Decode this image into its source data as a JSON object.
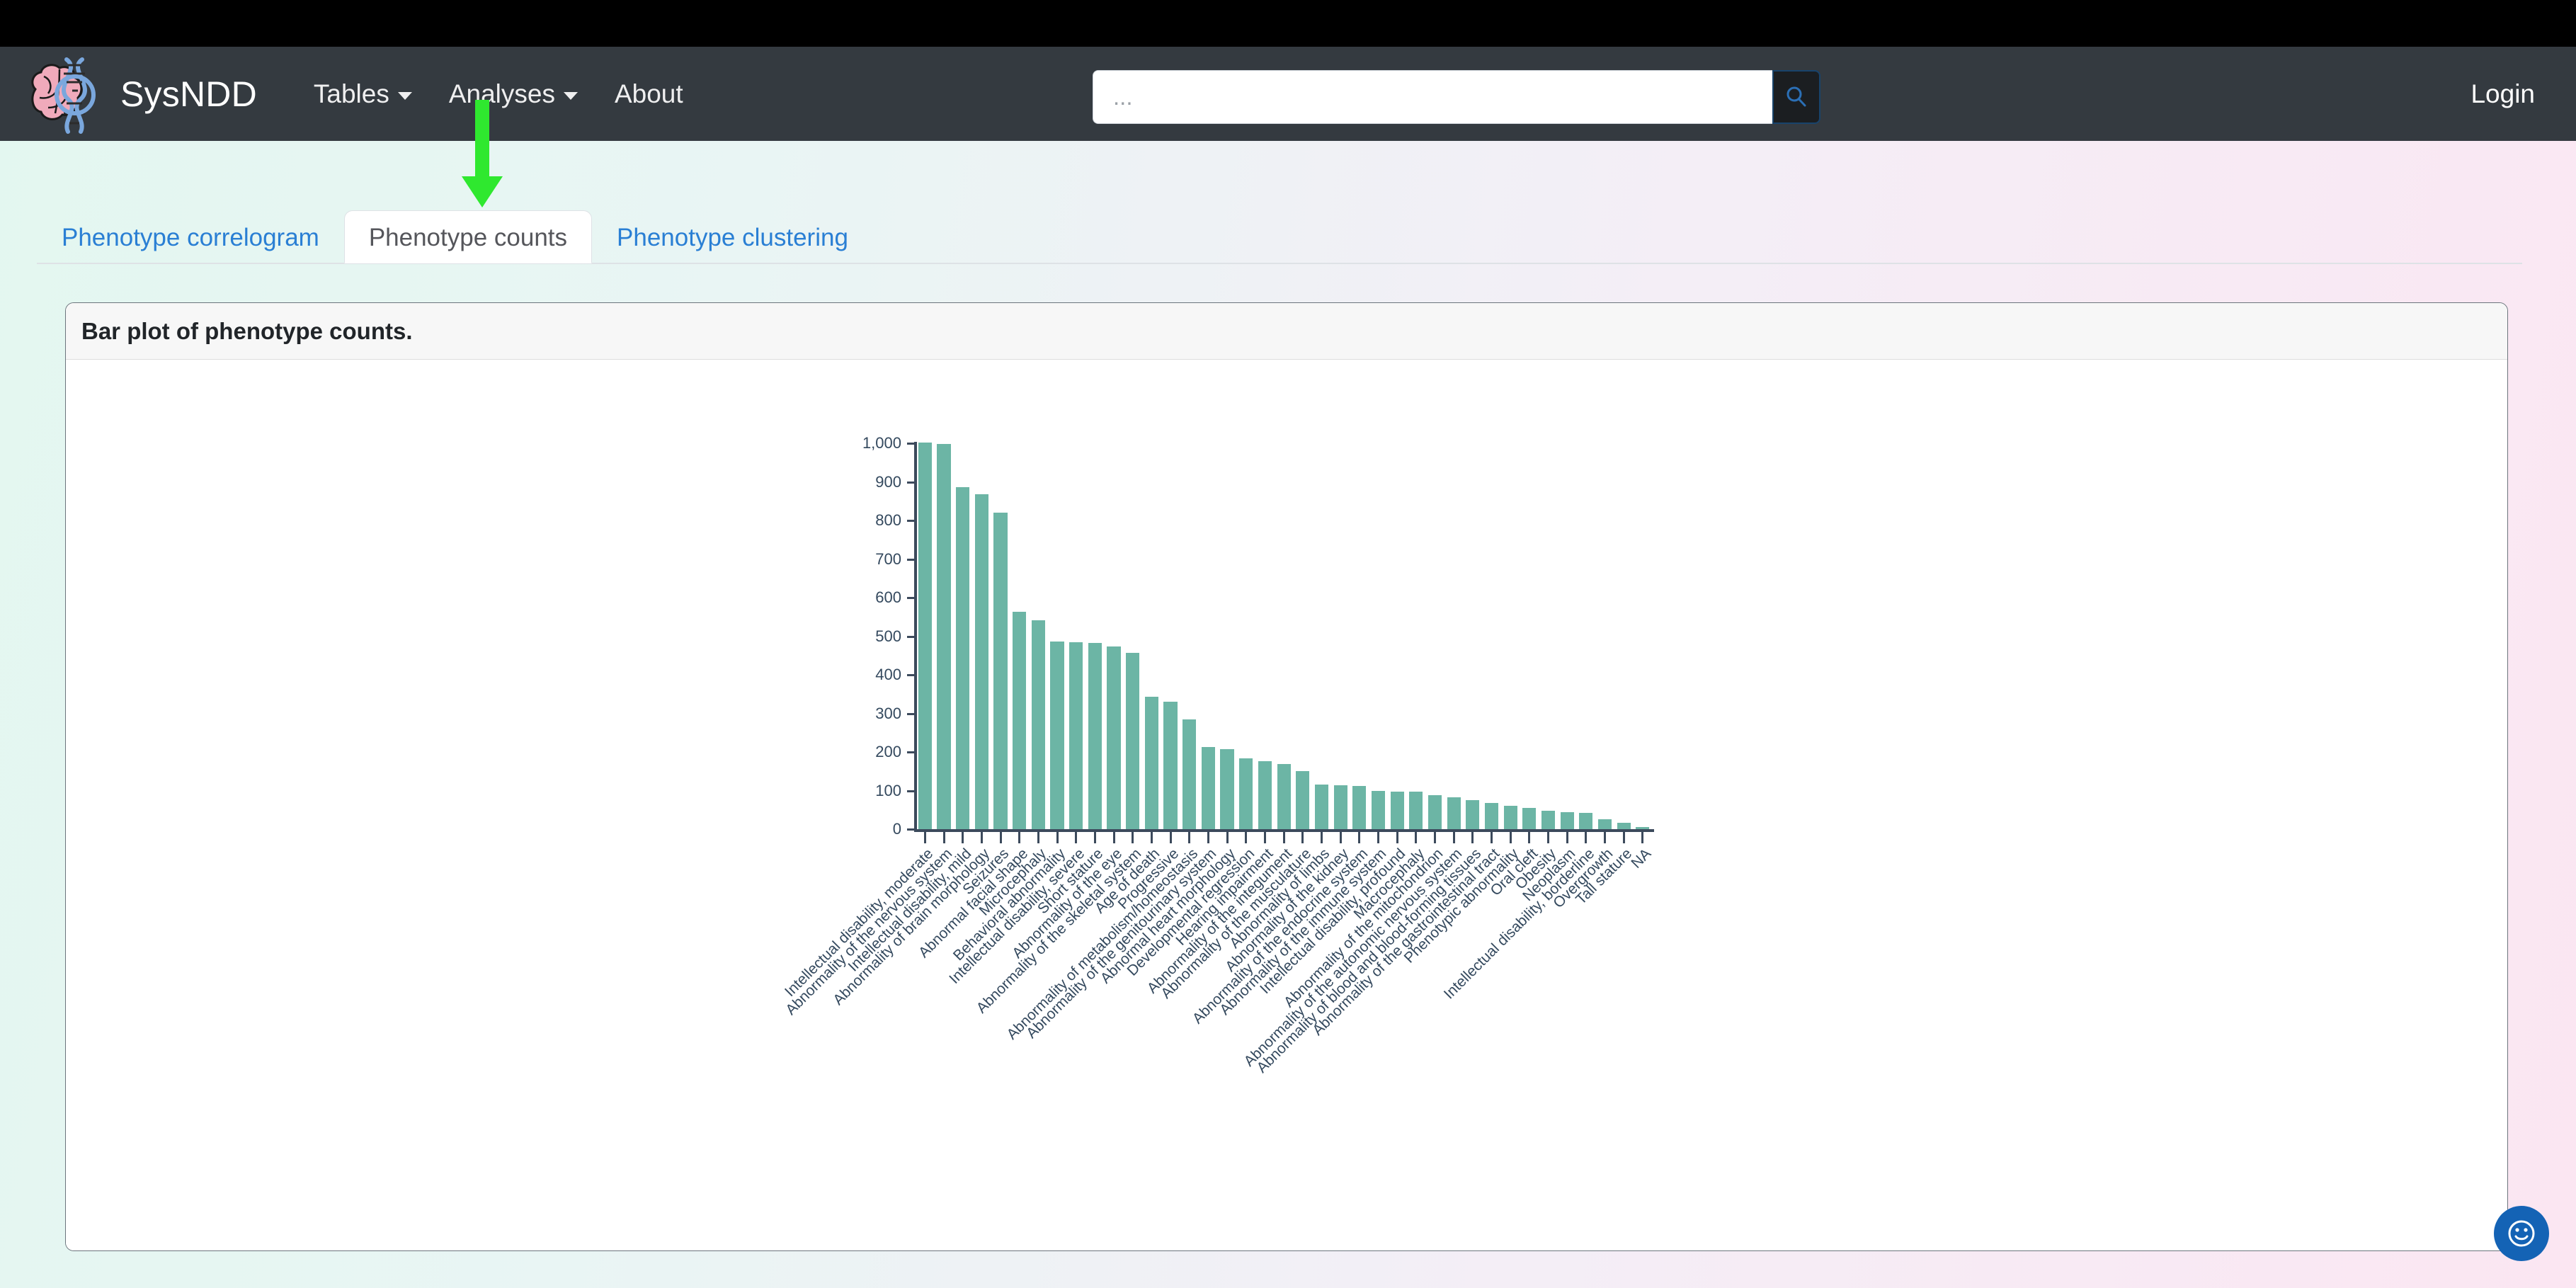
{
  "navbar": {
    "brand": "SysNDD",
    "brand_logo_icon": "brain-dna-logo-icon",
    "links": [
      {
        "label": "Tables",
        "has_caret": true
      },
      {
        "label": "Analyses",
        "has_caret": true
      },
      {
        "label": "About",
        "has_caret": false
      }
    ],
    "search": {
      "placeholder": "...",
      "value": "",
      "icon": "search-icon"
    },
    "login_label": "Login"
  },
  "annotation": {
    "arrow_icon": "green-down-arrow-icon",
    "color": "#2fe82f"
  },
  "tabs": {
    "items": [
      {
        "label": "Phenotype correlogram",
        "active": false
      },
      {
        "label": "Phenotype counts",
        "active": true
      },
      {
        "label": "Phenotype clustering",
        "active": false
      }
    ]
  },
  "card": {
    "title": "Bar plot of phenotype counts."
  },
  "fab": {
    "icon": "smiley-feedback-icon",
    "color": "#1463b5"
  },
  "colors": {
    "bar": "#6cb5a5",
    "axis": "#3c4a5c",
    "tick_label": "#34495e",
    "navbar": "#343a40",
    "tab_link": "#2a7fd4",
    "page_gradient_start": "#e3f7f0",
    "page_gradient_end": "#fbe6f2"
  },
  "chart_data": {
    "type": "bar",
    "title": "Bar plot of phenotype counts.",
    "xlabel": "",
    "ylabel": "",
    "ylim": [
      0,
      1000
    ],
    "grid": false,
    "legend": null,
    "ytick_labels": [
      "0",
      "100",
      "200",
      "300",
      "400",
      "500",
      "600",
      "700",
      "800",
      "900",
      "1,000"
    ],
    "ytick_values": [
      0,
      100,
      200,
      300,
      400,
      500,
      600,
      700,
      800,
      900,
      1000
    ],
    "categories": [
      "Intellectual disability, moderate",
      "Abnormality of the nervous system",
      "Intellectual disability, mild",
      "Abnormality of brain morphology",
      "Seizures",
      "Abnormal facial shape",
      "Microcephaly",
      "Behavioral abnormality",
      "Intellectual disability, severe",
      "Short stature",
      "Abnormality of the eye",
      "Abnormality of the skeletal system",
      "Age of death",
      "Progressive",
      "Abnormality of metabolism/homeostasis",
      "Abnormality of the genitourinary system",
      "Abnormal heart morphology",
      "Developmental regression",
      "Hearing impairment",
      "Abnormality of the integument",
      "Abnormality of the musculature",
      "Abnormality of limbs",
      "Abnormality of the kidney",
      "Abnormality of the endocrine system",
      "Abnormality of the immune system",
      "Intellectual disability, profound",
      "Macrocephaly",
      "Abnormality of the mitochondrion",
      "Abnormality of the autonomic nervous system",
      "Abnormality of blood and blood-forming tissues",
      "Abnormality of the gastrointestinal tract",
      "Phenotypic abnormality",
      "Oral cleft",
      "Obesity",
      "Neoplasm",
      "Intellectual disability, borderline",
      "Overgrowth",
      "Tall stature",
      "NA"
    ],
    "values": [
      1002,
      998,
      886,
      868,
      820,
      563,
      542,
      487,
      485,
      483,
      473,
      456,
      344,
      330,
      285,
      212,
      207,
      184,
      176,
      168,
      150,
      116,
      114,
      112,
      100,
      98,
      97,
      88,
      83,
      76,
      68,
      60,
      55,
      48,
      44,
      42,
      26,
      17,
      5
    ]
  }
}
